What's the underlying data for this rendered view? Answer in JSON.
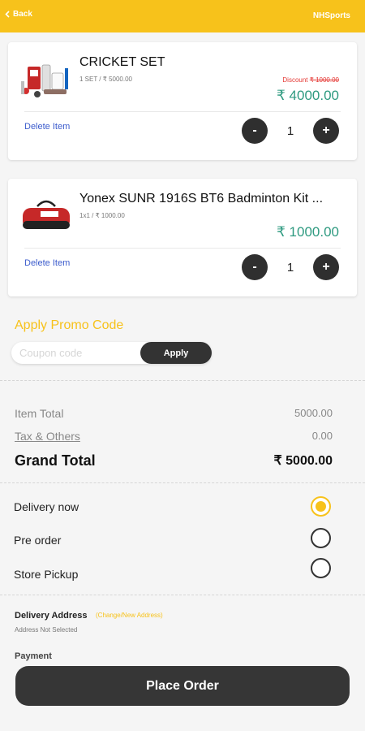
{
  "header": {
    "back_label": "Back",
    "brand": "NHSports"
  },
  "cart": [
    {
      "name": "CRICKET SET",
      "sub": "1 SET / ₹ 5000.00",
      "discount_prefix": "Discount",
      "discount_value": "₹ 1000.00",
      "price": "₹ 4000.00",
      "delete_label": "Delete Item",
      "qty": "1",
      "minus": "-",
      "plus": "+"
    },
    {
      "name": "Yonex SUNR 1916S BT6 Badminton Kit ...",
      "sub": "1x1 / ₹ 1000.00",
      "price": "₹ 1000.00",
      "delete_label": "Delete Item",
      "qty": "1",
      "minus": "-",
      "plus": "+"
    }
  ],
  "promo": {
    "title": "Apply Promo Code",
    "placeholder": "Coupon code",
    "apply_label": "Apply"
  },
  "summary": {
    "item_total_label": "Item Total",
    "item_total": "5000.00",
    "tax_label": "Tax & Others",
    "tax": "0.00",
    "grand_label": "Grand Total",
    "grand_total": "₹ 5000.00"
  },
  "delivery": {
    "options": [
      {
        "label": "Delivery now",
        "selected": true
      },
      {
        "label": "Pre order",
        "selected": false
      },
      {
        "label": "Store Pickup",
        "selected": false
      }
    ]
  },
  "address": {
    "label": "Delivery Address",
    "change_label": "(Change/New Address)",
    "status": "Address Not Selected",
    "next_label": "Payment"
  },
  "footer": {
    "place_order_label": "Place Order"
  },
  "colors": {
    "accent": "#f7c21b",
    "price": "#2e9a80",
    "link": "#3b5bcc",
    "discount": "#e53935",
    "dark": "#363636"
  },
  "icons": [
    "back-chevron-icon",
    "minus-icon",
    "plus-icon"
  ]
}
